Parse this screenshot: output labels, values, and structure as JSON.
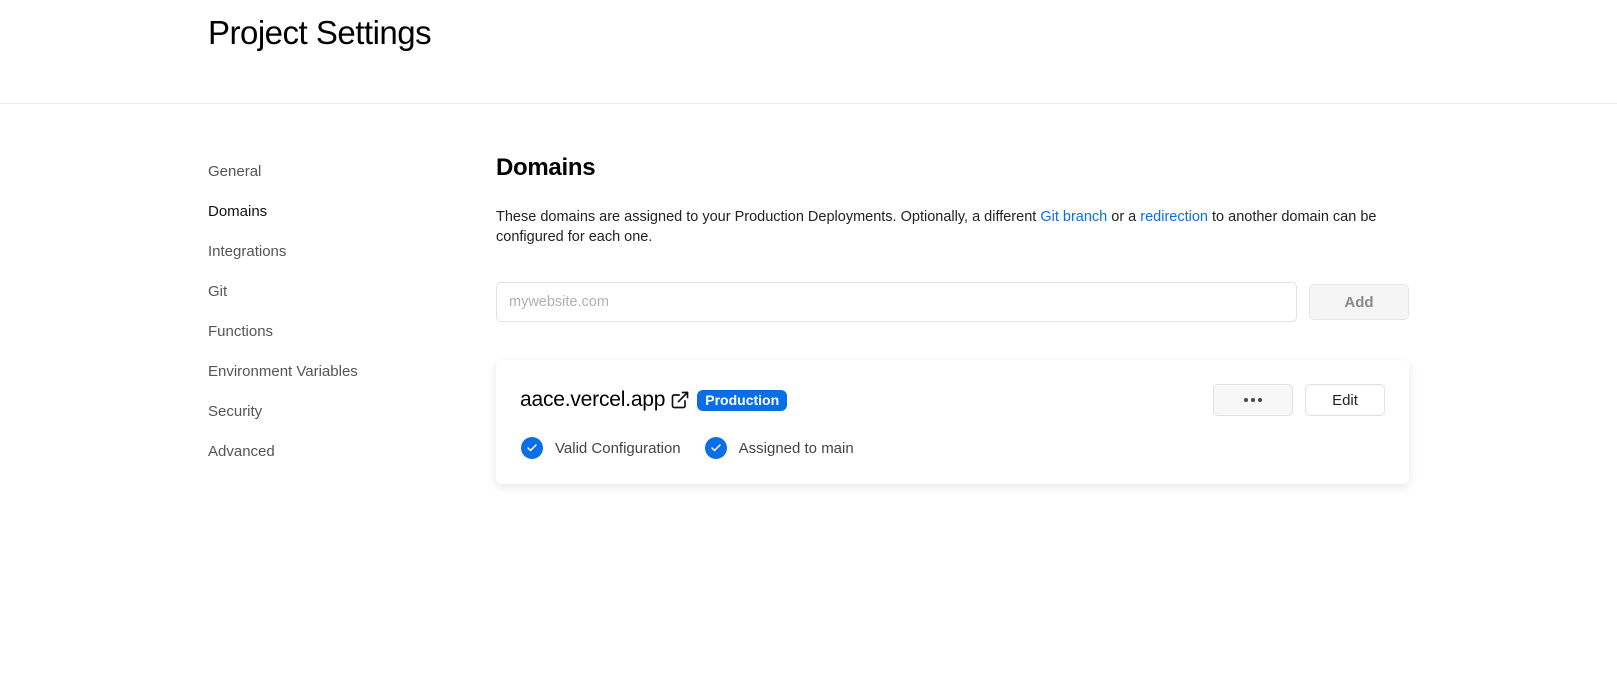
{
  "header": {
    "title": "Project Settings"
  },
  "sidebar": {
    "items": [
      {
        "label": "General"
      },
      {
        "label": "Domains",
        "active": true
      },
      {
        "label": "Integrations"
      },
      {
        "label": "Git"
      },
      {
        "label": "Functions"
      },
      {
        "label": "Environment Variables"
      },
      {
        "label": "Security"
      },
      {
        "label": "Advanced"
      }
    ]
  },
  "main": {
    "title": "Domains",
    "description": {
      "part1": "These domains are assigned to your Production Deployments. Optionally, a different ",
      "link1": "Git branch",
      "part2": " or a ",
      "link2": "redirection",
      "part3": " to another domain can be configured for each one."
    },
    "add_form": {
      "placeholder": "mywebsite.com",
      "value": "",
      "button_label": "Add"
    },
    "domains": [
      {
        "name": "aace.vercel.app",
        "badge": "Production",
        "edit_label": "Edit",
        "statuses": [
          {
            "label": "Valid Configuration"
          },
          {
            "label": "Assigned to main"
          }
        ]
      }
    ]
  },
  "icons": {
    "external_link": "external-link-icon",
    "check": "check-circle-icon",
    "more": "more-horizontal-icon"
  },
  "colors": {
    "accent": "#0a6fe6",
    "border": "#eaeaea",
    "text_muted": "#555555"
  }
}
